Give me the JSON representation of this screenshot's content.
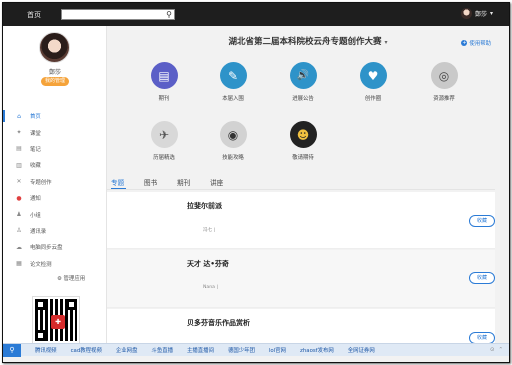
{
  "topbar": {
    "home_label": "首页",
    "search_placeholder": "",
    "search_icon": "search-icon",
    "user_name": "鄭莎",
    "user_caret": "▾"
  },
  "sidebar": {
    "user_name": "鄭莎",
    "user_badge": "我的管理",
    "items": [
      {
        "label": "首页",
        "icon": "home-icon",
        "glyph": "⌂",
        "active": true
      },
      {
        "label": "课堂",
        "icon": "class-icon",
        "glyph": "✦"
      },
      {
        "label": "笔记",
        "icon": "note-icon",
        "glyph": "▤"
      },
      {
        "label": "收藏",
        "icon": "bookmark-icon",
        "glyph": "▥"
      },
      {
        "label": "专题创作",
        "icon": "create-icon",
        "glyph": "✕"
      },
      {
        "label": "通知",
        "icon": "bell-icon",
        "glyph": "●"
      },
      {
        "label": "小组",
        "icon": "group-icon",
        "glyph": "♟"
      },
      {
        "label": "通讯录",
        "icon": "contacts-icon",
        "glyph": "♙"
      },
      {
        "label": "电脑同步云盘",
        "icon": "cloud-icon",
        "glyph": "☁"
      },
      {
        "label": "论文检测",
        "icon": "doc-check-icon",
        "glyph": "▦"
      }
    ],
    "manage_label": "⚙ 管理应用"
  },
  "main": {
    "title": "湖北省第二届本科院校云舟专题创作大赛",
    "title_caret": "▾",
    "help_label": "使用帮助",
    "apps": [
      {
        "label": "期刊",
        "icon": "journal-icon",
        "color": "#5b5fc7",
        "glyph": "▤"
      },
      {
        "label": "本届入围",
        "icon": "pen-icon",
        "color": "#2e93c9",
        "glyph": "✎"
      },
      {
        "label": "进展公告",
        "icon": "speaker-icon",
        "color": "#2e93c9",
        "glyph": "🔊"
      },
      {
        "label": "创作圈",
        "icon": "heart-hands-icon",
        "color": "#2e93c9",
        "glyph": "♥"
      },
      {
        "label": "资源推荐",
        "icon": "media-icon",
        "color": "#c9c9c9",
        "glyph": "◎"
      },
      {
        "label": "历届精选",
        "icon": "plane-icon",
        "color": "#d8d8d8",
        "glyph": "✈"
      },
      {
        "label": "技能攻略",
        "icon": "controller-icon",
        "color": "#d2d2d2",
        "glyph": "◉"
      },
      {
        "label": "敬请期待",
        "icon": "robot-icon",
        "color": "#222222",
        "glyph": "☻"
      }
    ],
    "tabs": [
      "专题",
      "图书",
      "期刊",
      "讲座"
    ],
    "cards": [
      {
        "title": "拉斐尔前派",
        "sub": "冯七 |",
        "fav": "收藏"
      },
      {
        "title": "天才 达•芬奇",
        "sub": "Nana |",
        "fav": "收藏"
      },
      {
        "title": "贝多芬音乐作品赏析",
        "sub": "",
        "fav": "收藏"
      }
    ]
  },
  "bottombar": {
    "search_icon": "search-icon",
    "links": [
      "腾讯视频",
      "cad教程视频",
      "企业网盘",
      "斗鱼直播",
      "主播直播间",
      "德国少年团",
      "lol官网",
      "zhaosf发布网",
      "全网证券网"
    ],
    "right_icons": [
      "⊙",
      "⌃"
    ]
  },
  "colors": {
    "accent": "#2b7bd6",
    "badge": "#f5a33a",
    "topbar": "#1e1e1e"
  }
}
